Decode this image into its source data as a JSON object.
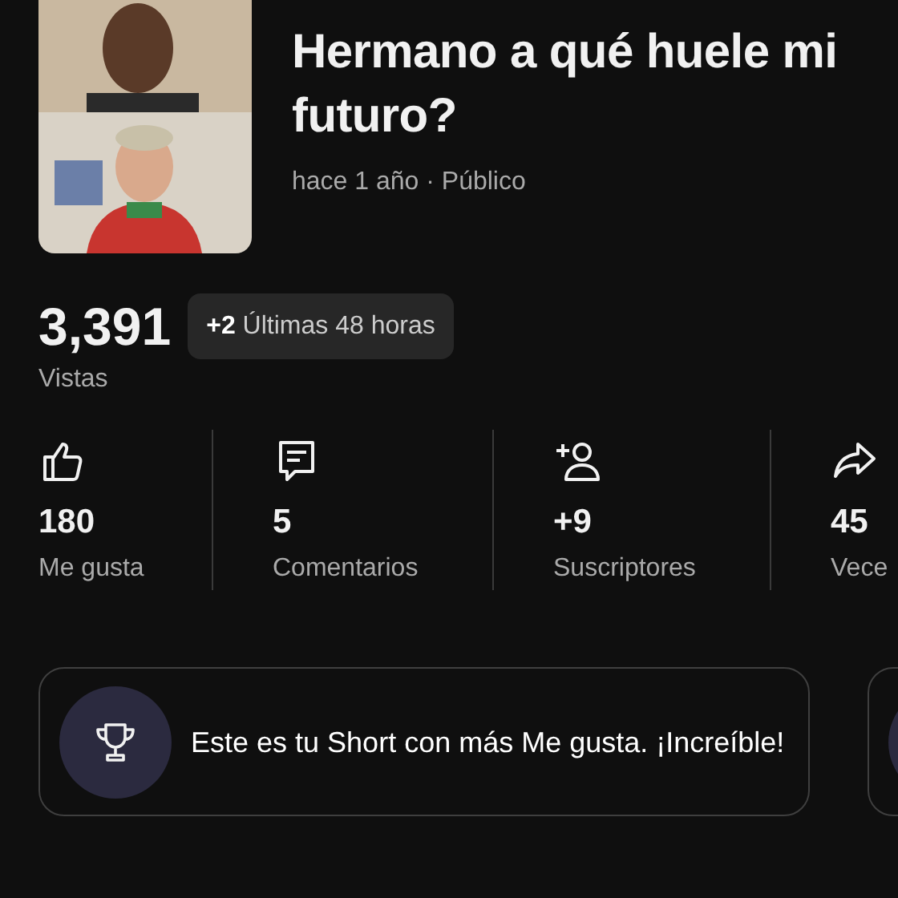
{
  "video": {
    "title": "Hermano a qué huele mi futuro?",
    "meta": "hace 1 año · Público"
  },
  "views": {
    "count": "3,391",
    "delta": "**+2** Últimas 48 horas",
    "label": "Vistas"
  },
  "stats": [
    {
      "kind": "likes",
      "value": "180",
      "label": "Me gusta"
    },
    {
      "kind": "comments",
      "value": "5",
      "label": "Comentarios"
    },
    {
      "kind": "subscribers",
      "value": "+9",
      "label": "Suscriptores"
    },
    {
      "kind": "shares",
      "value": "45",
      "label": "Vece"
    }
  ],
  "highlights": [
    {
      "kind": "trophy",
      "text": "Este es tu Short con más Me gusta. ¡Increíble!"
    },
    {
      "kind": "partial"
    }
  ]
}
